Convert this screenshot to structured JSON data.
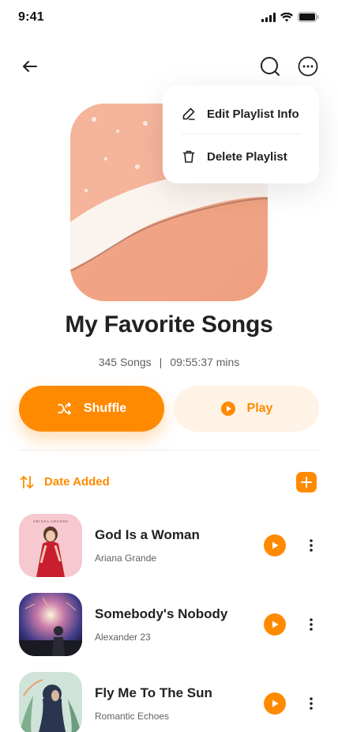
{
  "status_bar": {
    "time": "9:41"
  },
  "header": {
    "back_icon": "arrow-left-icon",
    "search_icon": "search-icon",
    "more_icon": "more-horizontal-circle-icon"
  },
  "menu": {
    "items": [
      {
        "label": "Edit Playlist Info",
        "icon": "edit-icon"
      },
      {
        "label": "Delete Playlist",
        "icon": "trash-icon"
      }
    ]
  },
  "playlist": {
    "title": "My Favorite Songs",
    "song_count": "345 Songs",
    "separator": "|",
    "duration": "09:55:37 mins"
  },
  "actions": {
    "shuffle_label": "Shuffle",
    "play_label": "Play"
  },
  "sort": {
    "label": "Date Added",
    "icon": "sort-arrows-icon",
    "add_icon": "plus-icon"
  },
  "songs": [
    {
      "title": "God Is a Woman",
      "artist": "Ariana Grande",
      "cover_text": "ARIANA GRANDE"
    },
    {
      "title": "Somebody's Nobody",
      "artist": "Alexander 23"
    },
    {
      "title": "Fly Me To The Sun",
      "artist": "Romantic Echoes"
    }
  ],
  "colors": {
    "accent": "#FF8A00",
    "accent_light": "#FFF3E5",
    "text_primary": "#212121",
    "text_secondary": "#616161"
  }
}
